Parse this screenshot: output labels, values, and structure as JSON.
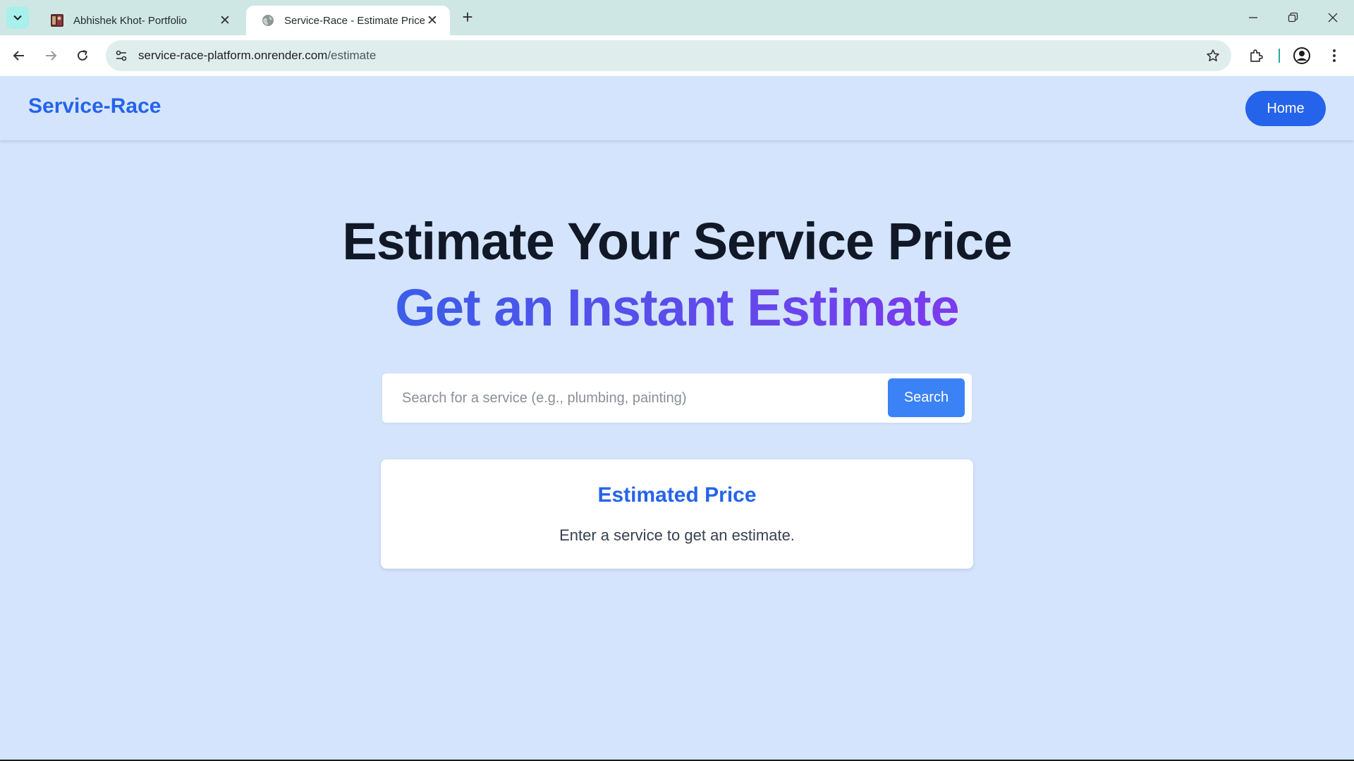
{
  "browser": {
    "tabs": [
      {
        "title": "Abhishek Khot- Portfolio",
        "active": false
      },
      {
        "title": "Service-Race - Estimate Price",
        "active": true
      }
    ],
    "url_host": "service-race-platform.onrender.com",
    "url_path": "/estimate"
  },
  "header": {
    "brand": "Service-Race",
    "home_label": "Home"
  },
  "hero": {
    "title": "Estimate Your Service Price",
    "subtitle": "Get an Instant Estimate"
  },
  "search": {
    "placeholder": "Search for a service (e.g., plumbing, painting)",
    "value": "",
    "button_label": "Search"
  },
  "result": {
    "title": "Estimated Price",
    "text": "Enter a service to get an estimate."
  },
  "colors": {
    "brand": "#2563eb",
    "page_bg": "#d4e4fc",
    "search_button": "#3b82f6",
    "gradient_start": "#3b5ee8",
    "gradient_end": "#7c3aed"
  }
}
